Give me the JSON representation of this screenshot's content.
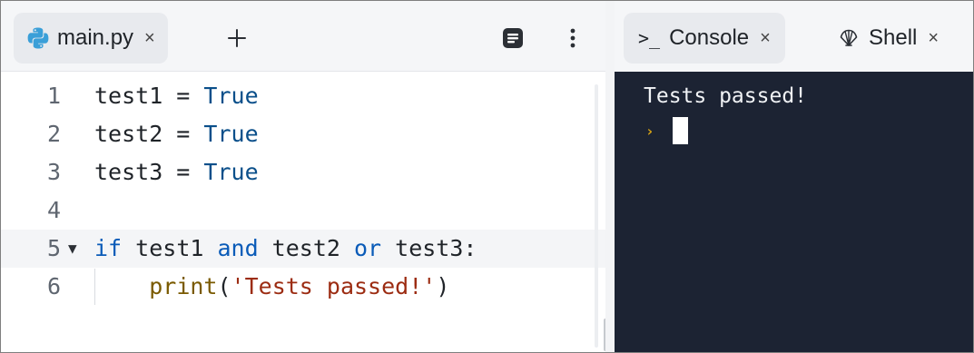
{
  "editor": {
    "tabs": [
      {
        "label": "main.py",
        "close": "×",
        "icon": "python-icon"
      }
    ],
    "add_tab_icon": "plus-icon",
    "format_icon": "format-icon",
    "more_icon": "more-vertical-icon",
    "active_line": 5,
    "lines": [
      {
        "num": "1",
        "tokens": [
          [
            "test1 = ",
            "plain"
          ],
          [
            "True",
            "const"
          ]
        ]
      },
      {
        "num": "2",
        "tokens": [
          [
            "test2 = ",
            "plain"
          ],
          [
            "True",
            "const"
          ]
        ]
      },
      {
        "num": "3",
        "tokens": [
          [
            "test3 = ",
            "plain"
          ],
          [
            "True",
            "const"
          ]
        ]
      },
      {
        "num": "4",
        "tokens": []
      },
      {
        "num": "5",
        "fold": "▼",
        "tokens": [
          [
            "if",
            "kw"
          ],
          [
            " test1 ",
            "plain"
          ],
          [
            "and",
            "op"
          ],
          [
            " test2 ",
            "plain"
          ],
          [
            "or",
            "op"
          ],
          [
            " test3:",
            "plain"
          ]
        ]
      },
      {
        "num": "6",
        "tokens": [
          [
            "    ",
            "plain"
          ],
          [
            "print",
            "fn"
          ],
          [
            "(",
            "plain"
          ],
          [
            "'Tests passed!'",
            "str"
          ],
          [
            ")",
            "plain"
          ]
        ]
      }
    ]
  },
  "console": {
    "tabs": [
      {
        "label": "Console",
        "glyph": ">_",
        "close": "×",
        "icon": "terminal-icon"
      },
      {
        "label": "Shell",
        "close": "×",
        "icon": "shell-icon"
      }
    ],
    "output": "Tests passed!",
    "prompt": "›"
  },
  "colors": {
    "terminal_bg": "#1c2333",
    "keyword": "#0a5bb8",
    "string": "#9c2c12",
    "function": "#7a5a00",
    "prompt": "#d9a514"
  }
}
